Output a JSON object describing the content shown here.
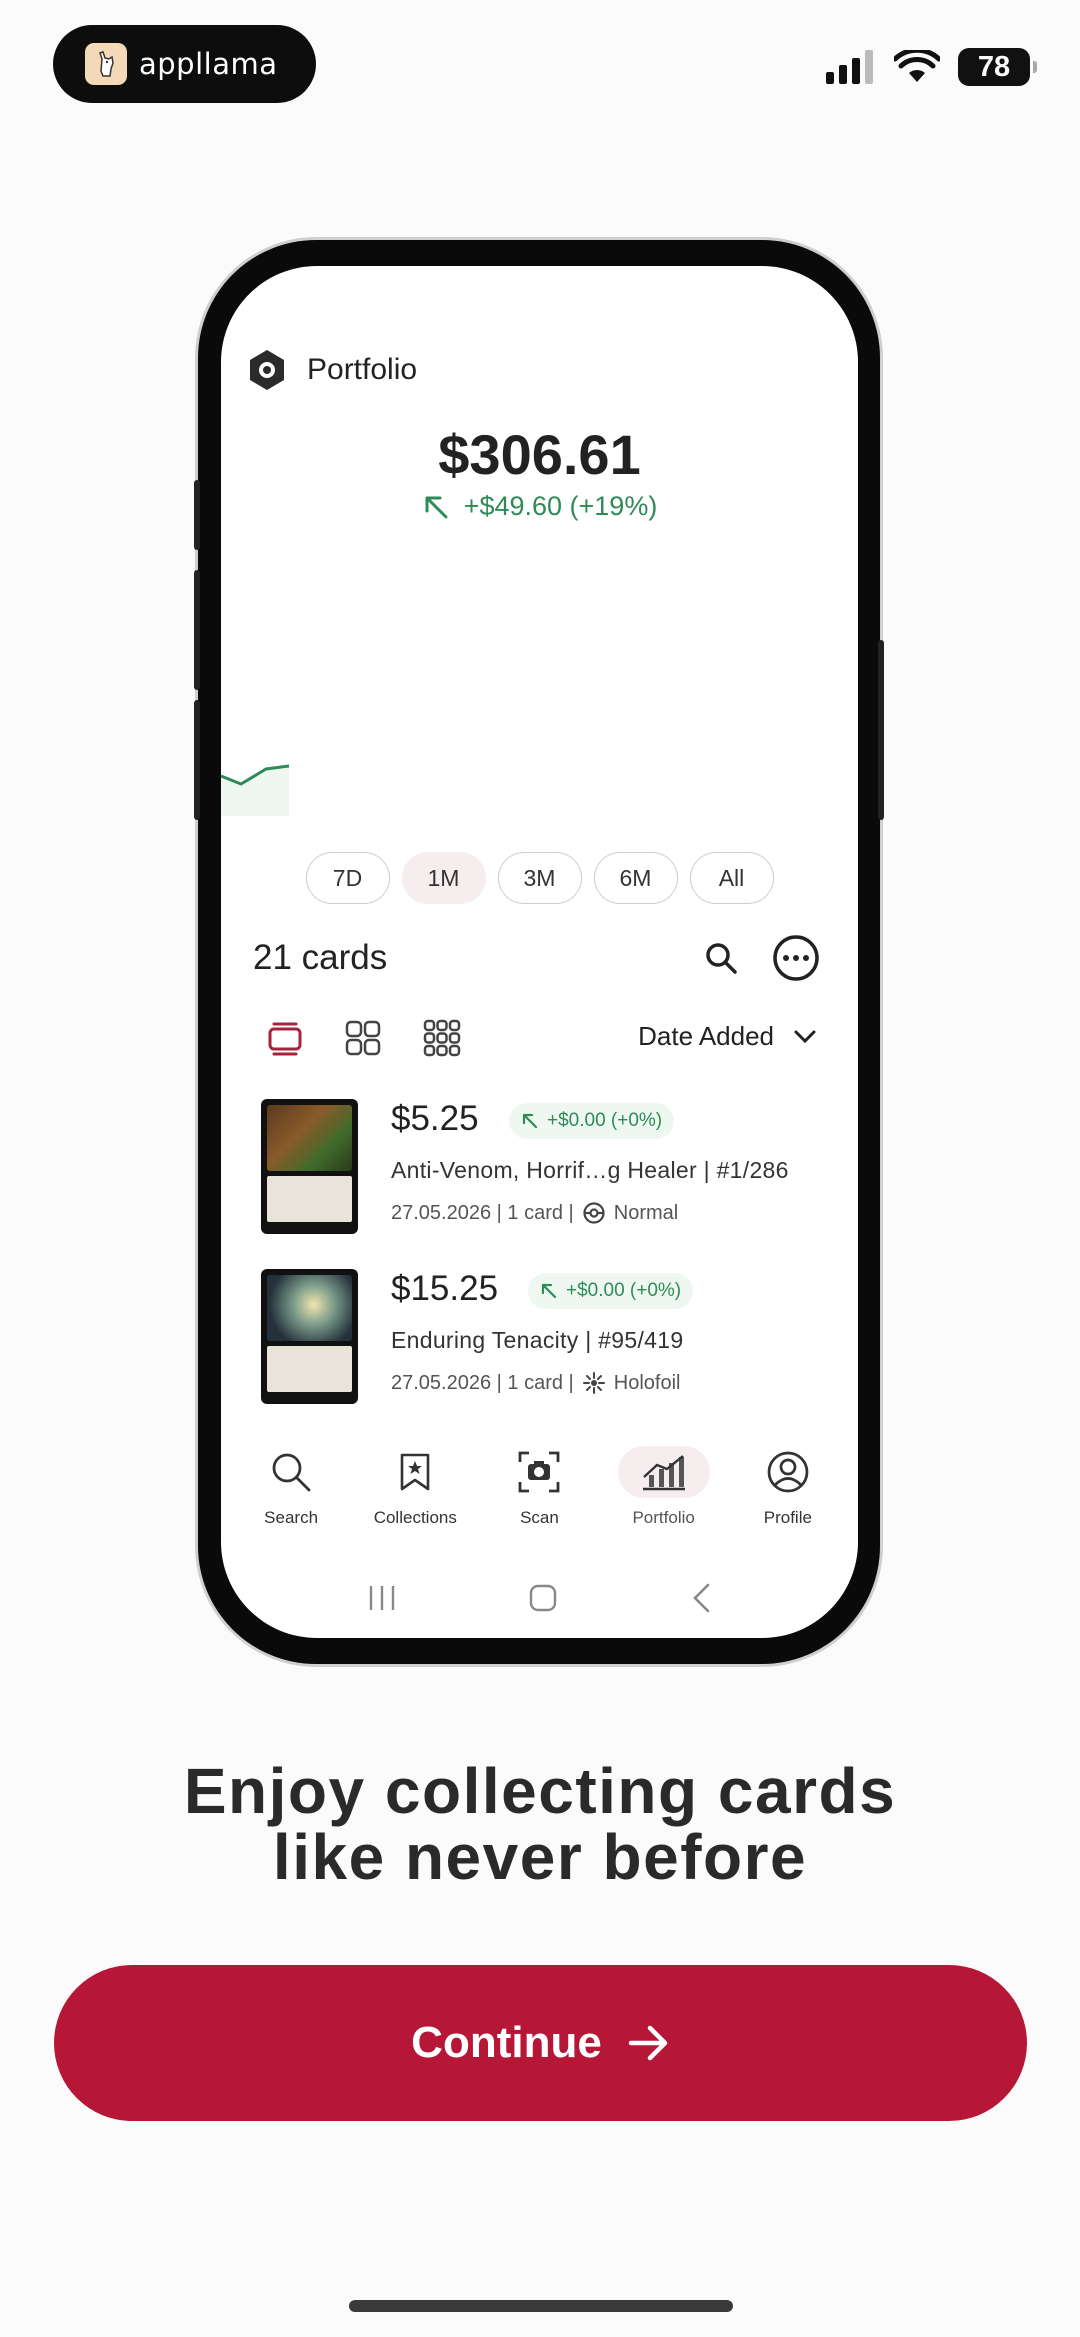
{
  "status_bar": {
    "brand": "appllama",
    "battery": "78",
    "icons": [
      "signal-icon",
      "wifi-icon",
      "battery-icon"
    ]
  },
  "portfolio_screen": {
    "title": "Portfolio",
    "total_value": "$306.61",
    "change": "+$49.60 (+19%)",
    "change_color": "#2e8b57",
    "ranges": [
      "7D",
      "1M",
      "3M",
      "6M",
      "All"
    ],
    "active_range": "1M",
    "cards_count": "21 cards",
    "sort_label": "Date Added",
    "cards": [
      {
        "price": "$5.25",
        "delta": "+$0.00 (+0%)",
        "name": "Anti-Venom, Horrif…g Healer | #1/286",
        "meta": "27.05.2026 | 1 card |",
        "finish": "Normal"
      },
      {
        "price": "$15.25",
        "delta": "+$0.00 (+0%)",
        "name": "Enduring Tenacity | #95/419",
        "meta": "27.05.2026 | 1 card |",
        "finish": "Holofoil"
      }
    ],
    "nav": [
      {
        "label": "Search",
        "icon": "search-icon"
      },
      {
        "label": "Collections",
        "icon": "bookmark-icon"
      },
      {
        "label": "Scan",
        "icon": "camera-icon"
      },
      {
        "label": "Portfolio",
        "icon": "chart-icon"
      },
      {
        "label": "Profile",
        "icon": "profile-icon"
      }
    ],
    "active_nav": "Portfolio"
  },
  "headline_line1": "Enjoy collecting cards",
  "headline_line2": "like never before",
  "cta_label": "Continue",
  "colors": {
    "brand_red": "#b71737",
    "positive_green": "#2e8b57",
    "background": "#fbfbfb"
  }
}
